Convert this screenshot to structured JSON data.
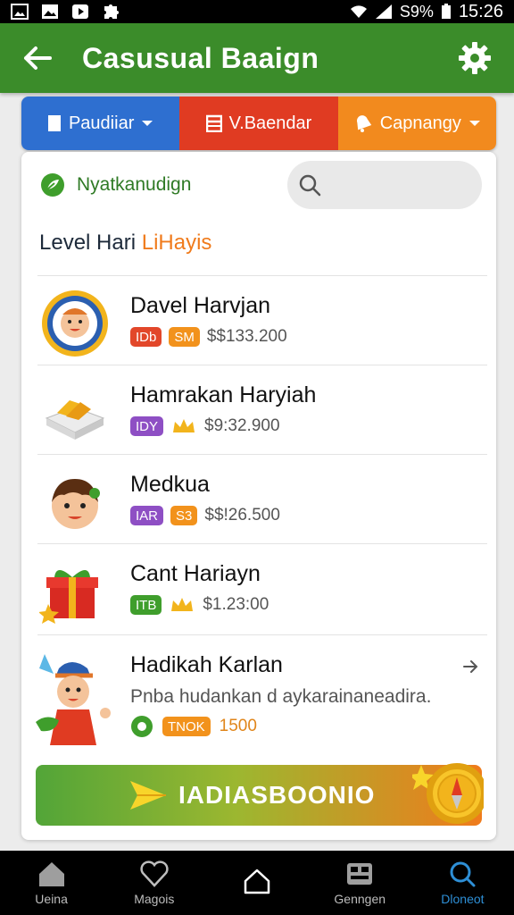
{
  "status_bar": {
    "battery": "S9%",
    "time": "15:26"
  },
  "app_bar": {
    "title": "Casusual Baaign"
  },
  "segments": [
    {
      "label": "Paudiiar",
      "icon": "document-icon",
      "color": "#2e6fd0"
    },
    {
      "label": "V.Baendar",
      "icon": "calendar-icon",
      "color": "#e03b22"
    },
    {
      "label": "Capnangy",
      "icon": "bell-icon",
      "color": "#f28a1e"
    }
  ],
  "brand": {
    "label": "Nyatkanudign"
  },
  "search": {
    "placeholder": ""
  },
  "list": {
    "heading_main": "Level Hari",
    "heading_highlight": "LiHayis",
    "items": [
      {
        "name": "Davel Harvjan",
        "chip1": "IDb",
        "chip2": "SM",
        "price": "$$133.200",
        "icon": "medal-badge-icon"
      },
      {
        "name": "Hamrakan Haryiah",
        "chip1": "IDY",
        "chip2": "",
        "price": "$9:32.900",
        "icon": "food-tray-icon"
      },
      {
        "name": "Medkua",
        "chip1": "IAR",
        "chip2": "S3",
        "price": "$$!26.500",
        "icon": "boy-avatar-icon"
      },
      {
        "name": "Cant Hariayn",
        "chip1": "ITB",
        "chip2": "",
        "price": "$1.23:00",
        "icon": "gift-box-icon"
      }
    ],
    "last_item": {
      "name": "Hadikah Karlan",
      "desc": "Pnba hudankan d aykarainaneadira.",
      "chip": "TNOK",
      "value": "1500",
      "icon": "girl-character-icon"
    }
  },
  "cta": {
    "label": "IADIASBOONIO"
  },
  "bottom_nav": [
    {
      "label": "Ueina",
      "icon": "home-icon",
      "active": false
    },
    {
      "label": "Magois",
      "icon": "heart-icon",
      "active": false
    },
    {
      "label": "",
      "icon": "house-outline-icon",
      "active": false
    },
    {
      "label": "Genngen",
      "icon": "gamepad-icon",
      "active": false
    },
    {
      "label": "Dloneot",
      "icon": "search-icon",
      "active": true
    }
  ]
}
